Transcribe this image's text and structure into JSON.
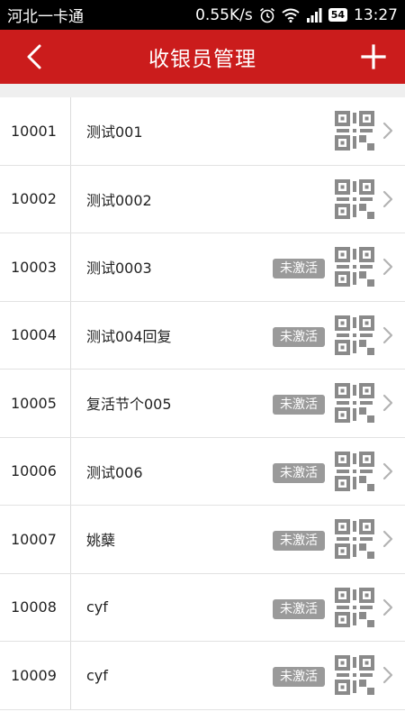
{
  "status_bar": {
    "carrier": "河北一卡通",
    "speed": "0.55K/s",
    "battery": "54",
    "time": "13:27"
  },
  "header": {
    "title": "收银员管理"
  },
  "cashiers": [
    {
      "id": "10001",
      "name": "测试001",
      "inactive_label": ""
    },
    {
      "id": "10002",
      "name": "测试0002",
      "inactive_label": ""
    },
    {
      "id": "10003",
      "name": "测试0003",
      "inactive_label": "未激活"
    },
    {
      "id": "10004",
      "name": "测试004回复",
      "inactive_label": "未激活"
    },
    {
      "id": "10005",
      "name": "复活节个005",
      "inactive_label": "未激活"
    },
    {
      "id": "10006",
      "name": "测试006",
      "inactive_label": "未激活"
    },
    {
      "id": "10007",
      "name": "姚蘖",
      "inactive_label": "未激活"
    },
    {
      "id": "10008",
      "name": "cyf",
      "inactive_label": "未激活"
    },
    {
      "id": "10009",
      "name": "cyf",
      "inactive_label": "未激活"
    }
  ],
  "colors": {
    "brand_red": "#cb1c1c",
    "badge_gray": "#9a9a9a",
    "qr_gray": "#8a8a8a"
  }
}
